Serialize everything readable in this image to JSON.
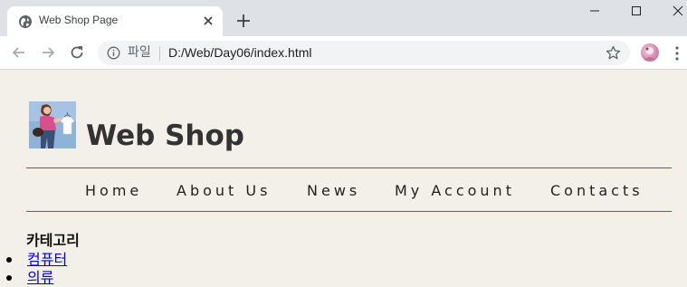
{
  "browser": {
    "tab_title": "Web Shop Page",
    "scheme_label": "파일",
    "url": "D:/Web/Day06/index.html",
    "icons": {
      "favicon": "globe-icon",
      "tab_close": "close-icon",
      "new_tab": "plus-icon",
      "back": "arrow-left-icon",
      "forward": "arrow-right-icon",
      "reload": "reload-icon",
      "info": "info-icon",
      "bookmark": "star-icon",
      "profile": "avatar",
      "menu": "kebab-menu-icon",
      "minimize": "minimize-icon",
      "maximize": "maximize-icon",
      "close_window": "close-icon"
    }
  },
  "page": {
    "header": {
      "logo": "shopper-logo-image",
      "title": "Web Shop"
    },
    "nav": [
      {
        "label": "Home"
      },
      {
        "label": "About Us"
      },
      {
        "label": "News"
      },
      {
        "label": "My Account"
      },
      {
        "label": "Contacts"
      }
    ],
    "categories": {
      "heading": "카테고리",
      "items": [
        {
          "label": "컴퓨터"
        },
        {
          "label": "의류"
        }
      ]
    },
    "colors": {
      "background": "#f3efe9",
      "rule": "#c0392b",
      "link": "#0000ee",
      "title": "#333333"
    }
  }
}
